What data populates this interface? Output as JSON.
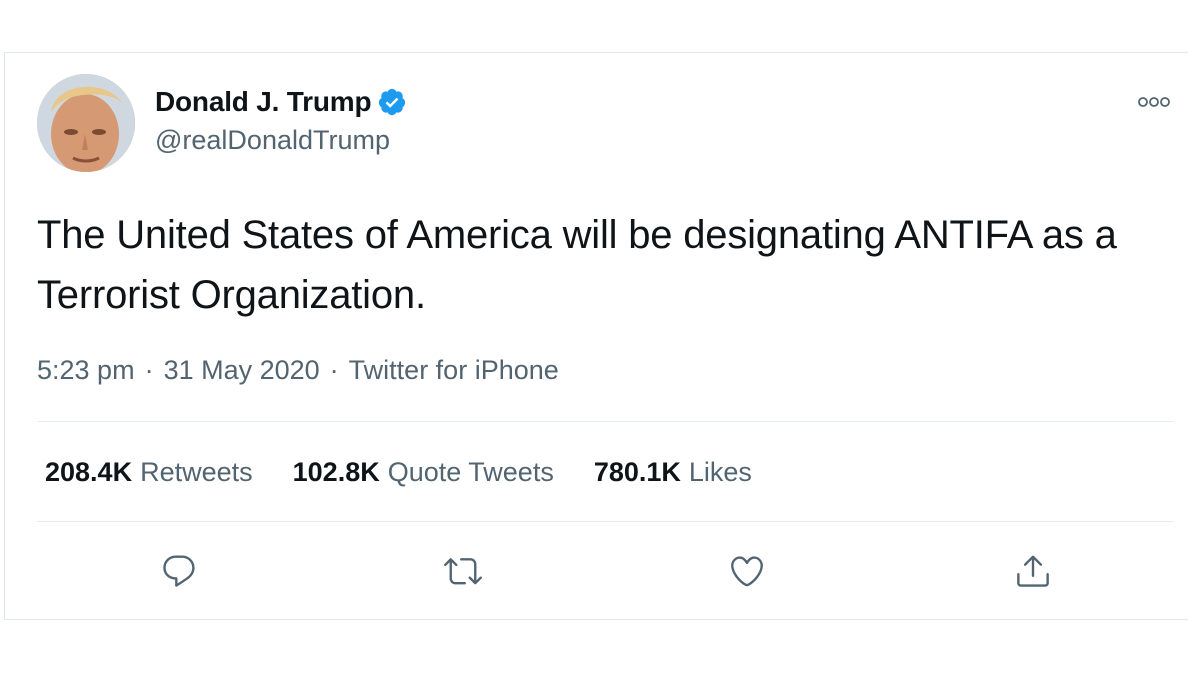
{
  "author": {
    "name": "Donald J. Trump",
    "handle": "@realDonaldTrump",
    "verified": true,
    "verified_color": "#1d9bf0"
  },
  "tweet": {
    "text": "The United States of America will be designating ANTIFA as a Terrorist Organization.",
    "time": "5:23 pm",
    "date": "31 May 2020",
    "source": "Twitter for iPhone",
    "separator": "·"
  },
  "stats": {
    "retweets": {
      "value": "208.4K",
      "label": "Retweets"
    },
    "quote_tweets": {
      "value": "102.8K",
      "label": "Quote Tweets"
    },
    "likes": {
      "value": "780.1K",
      "label": "Likes"
    }
  },
  "actions": [
    {
      "name": "reply",
      "icon": "reply-icon"
    },
    {
      "name": "retweet",
      "icon": "retweet-icon"
    },
    {
      "name": "like",
      "icon": "heart-icon"
    },
    {
      "name": "share",
      "icon": "share-icon"
    }
  ],
  "colors": {
    "text_primary": "#0f1419",
    "text_secondary": "#536471",
    "divider": "#e6ecf0",
    "icon": "#536471"
  }
}
